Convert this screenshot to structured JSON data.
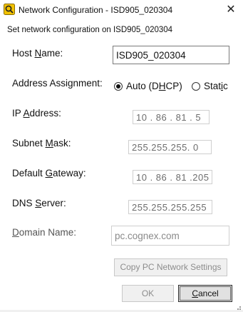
{
  "window": {
    "title": "Network Configuration - ISD905_020304",
    "close_glyph": "✕",
    "description": "Set network configuration on ISD905_020304"
  },
  "host_name": {
    "label_pre": "Host ",
    "label_u": "N",
    "label_post": "ame:",
    "value": "ISD905_020304"
  },
  "address_assignment": {
    "label": "Address Assignment:",
    "options": [
      {
        "label_pre": "Auto (D",
        "label_u": "H",
        "label_post": "CP)",
        "selected": true
      },
      {
        "label_pre": "Stat",
        "label_u": "i",
        "label_post": "c",
        "selected": false
      }
    ]
  },
  "ip_address": {
    "label_pre": "IP ",
    "label_u": "A",
    "label_post": "ddress:",
    "value": "10 . 86 . 81 . 5"
  },
  "subnet_mask": {
    "label_pre": "Subnet ",
    "label_u": "M",
    "label_post": "ask:",
    "value": "255.255.255. 0"
  },
  "default_gateway": {
    "label_pre": "Default ",
    "label_u": "G",
    "label_post": "ateway:",
    "value": "10 . 86 . 81 .205"
  },
  "dns_server": {
    "label_pre": "DNS ",
    "label_u": "S",
    "label_post": "erver:",
    "value": "255.255.255.255"
  },
  "domain_name": {
    "label_pre": "",
    "label_u": "D",
    "label_post": "omain Name:",
    "placeholder": "pc.cognex.com"
  },
  "buttons": {
    "copy": "Copy PC Network Settings",
    "ok": "OK",
    "cancel_pre": "",
    "cancel_u": "C",
    "cancel_post": "ancel"
  },
  "icons": {
    "app": "cognex-search-icon",
    "close": "close-icon"
  }
}
